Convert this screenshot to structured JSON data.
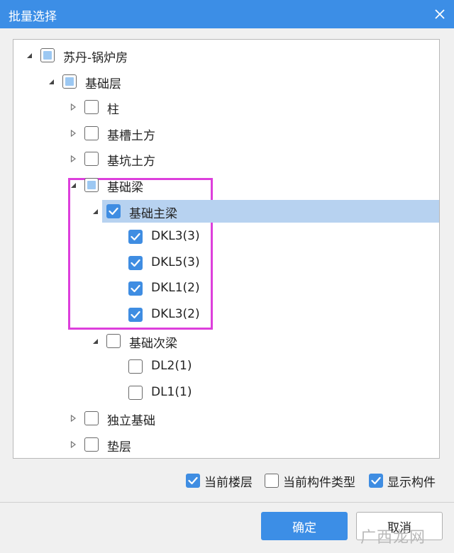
{
  "window": {
    "title": "批量选择"
  },
  "tree": [
    {
      "label": "苏丹-锅炉房",
      "level": 0,
      "expander": "expanded",
      "check": "partial"
    },
    {
      "label": "基础层",
      "level": 1,
      "expander": "expanded",
      "check": "partial"
    },
    {
      "label": "柱",
      "level": 2,
      "expander": "collapsed",
      "check": "unchecked"
    },
    {
      "label": "基槽土方",
      "level": 2,
      "expander": "collapsed",
      "check": "unchecked"
    },
    {
      "label": "基坑土方",
      "level": 2,
      "expander": "collapsed",
      "check": "unchecked"
    },
    {
      "label": "基础梁",
      "level": 2,
      "expander": "expanded",
      "check": "partial"
    },
    {
      "label": "基础主梁",
      "level": 3,
      "expander": "expanded",
      "check": "checked",
      "selected": true
    },
    {
      "label": "DKL3(3)",
      "level": 4,
      "expander": "none",
      "check": "checked"
    },
    {
      "label": "DKL5(3)",
      "level": 4,
      "expander": "none",
      "check": "checked"
    },
    {
      "label": "DKL1(2)",
      "level": 4,
      "expander": "none",
      "check": "checked"
    },
    {
      "label": "DKL3(2)",
      "level": 4,
      "expander": "none",
      "check": "checked"
    },
    {
      "label": "基础次梁",
      "level": 3,
      "expander": "expanded",
      "check": "unchecked"
    },
    {
      "label": "DL2(1)",
      "level": 4,
      "expander": "none",
      "check": "unchecked"
    },
    {
      "label": "DL1(1)",
      "level": 4,
      "expander": "none",
      "check": "unchecked"
    },
    {
      "label": "独立基础",
      "level": 2,
      "expander": "collapsed",
      "check": "unchecked"
    },
    {
      "label": "垫层",
      "level": 2,
      "expander": "collapsed",
      "check": "unchecked"
    }
  ],
  "options": {
    "current_floor": {
      "label": "当前楼层",
      "checked": true
    },
    "current_type": {
      "label": "当前构件类型",
      "checked": false
    },
    "show_components": {
      "label": "显示构件",
      "checked": true
    }
  },
  "buttons": {
    "ok": "确定",
    "cancel": "取消"
  },
  "watermark": "广西龙网",
  "colors": {
    "title_bar": "#3c8ee6",
    "checked": "#3f8de2",
    "partial": "#9cc8f2",
    "selection": "#b7d2f0",
    "highlight_box": "#dd3fdc"
  },
  "icons": {
    "close": "close-icon",
    "expanded": "triangle-down-icon",
    "collapsed": "triangle-right-icon",
    "check": "checkmark-icon"
  }
}
